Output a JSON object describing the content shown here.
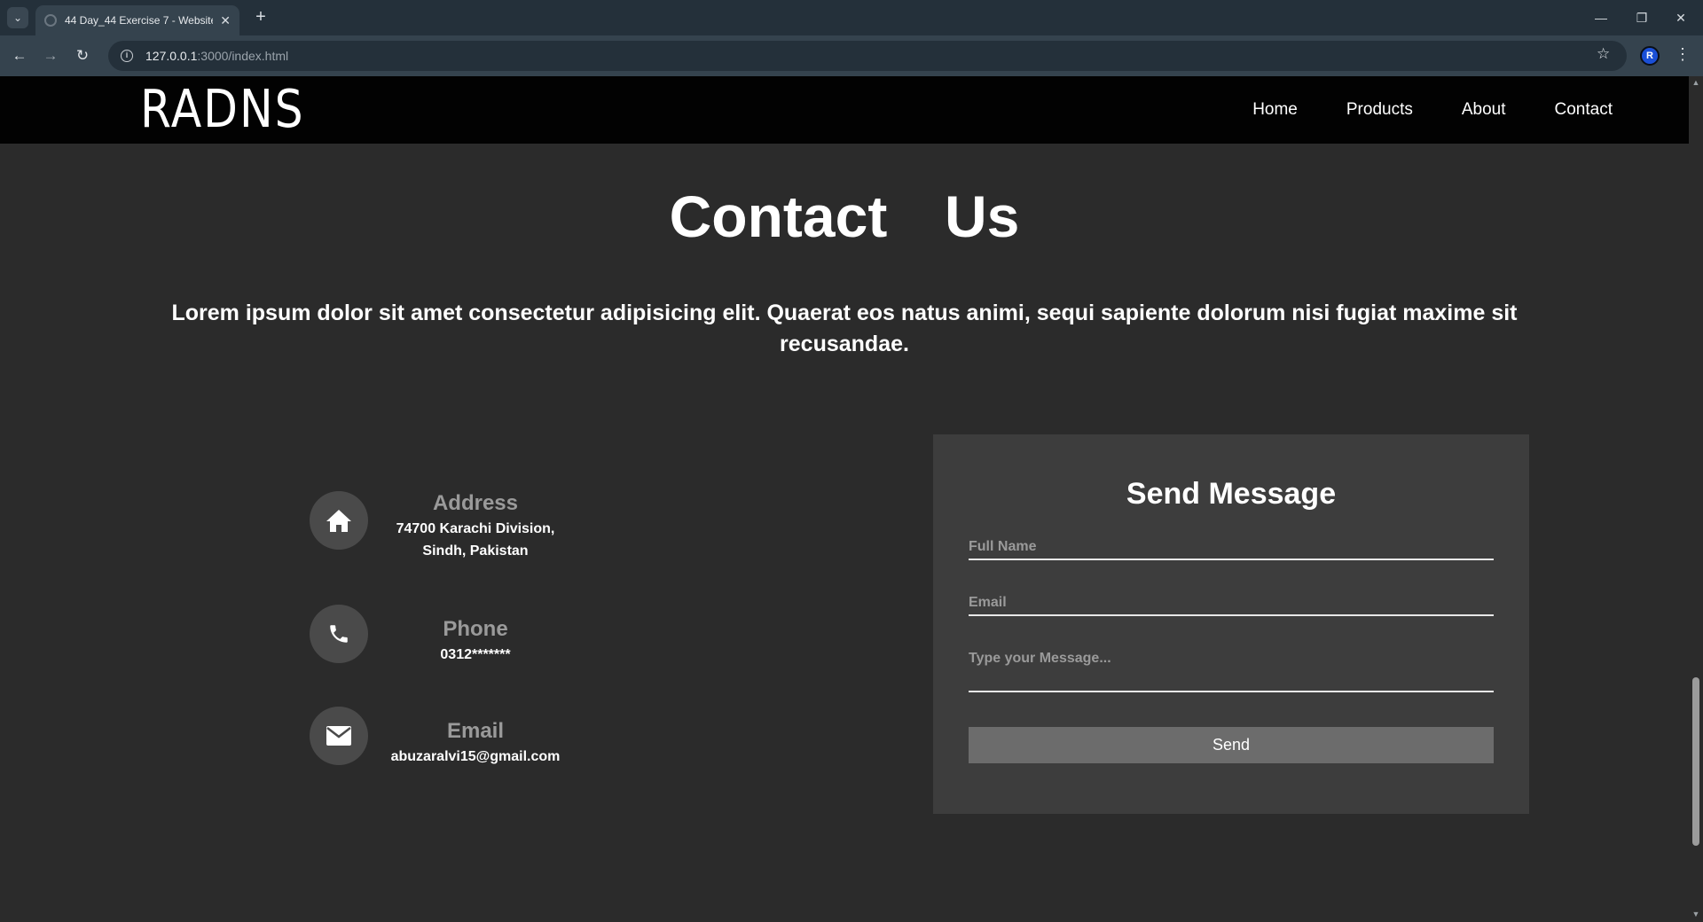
{
  "browser": {
    "tab_title": "44 Day_44 Exercise 7 - Website",
    "url_host": "127.0.0.1",
    "url_rest": ":3000/index.html"
  },
  "site": {
    "logo": "RADNS",
    "nav": [
      "Home",
      "Products",
      "About",
      "Contact"
    ]
  },
  "contact": {
    "heading": "Contact  Us",
    "lead": "Lorem ipsum dolor sit amet consectetur adipisicing elit. Quaerat eos natus animi, sequi sapiente dolorum nisi fugiat maxime sit recusandae.",
    "items": [
      {
        "label": "Address",
        "value": "74700 Karachi Division, Sindh, Pakistan",
        "icon": "home-icon"
      },
      {
        "label": "Phone",
        "value": "0312*******",
        "icon": "phone-icon"
      },
      {
        "label": "Email",
        "value": "abuzaralvi15@gmail.com",
        "icon": "mail-icon"
      }
    ]
  },
  "form": {
    "title": "Send Message",
    "full_name_placeholder": "Full Name",
    "email_placeholder": "Email",
    "message_placeholder": "Type your Message...",
    "send_label": "Send"
  }
}
